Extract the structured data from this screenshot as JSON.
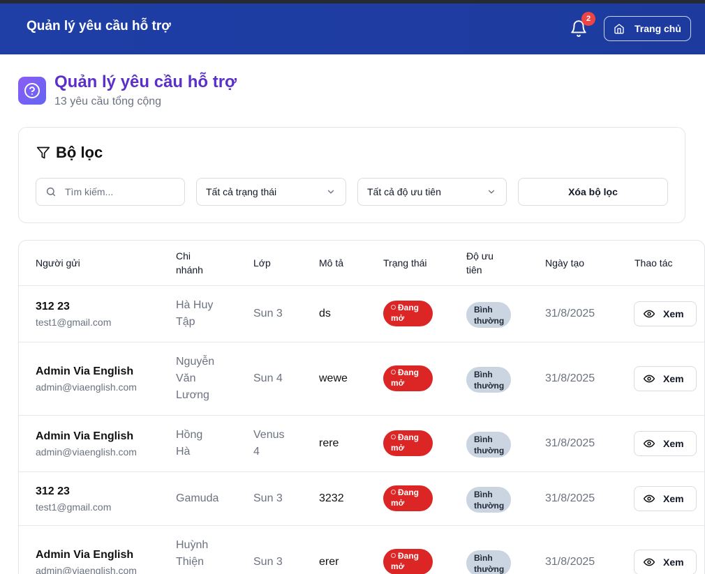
{
  "header": {
    "app_title": "Quản lý yêu cầu hỗ trợ",
    "notification_count": "2",
    "home_label": "Trang chủ"
  },
  "page": {
    "title": "Quản lý yêu cầu hỗ trợ",
    "subtitle": "13 yêu cầu tổng cộng"
  },
  "filters": {
    "title": "Bộ lọc",
    "search_placeholder": "Tìm kiếm...",
    "status_value": "Tất cả trạng thái",
    "priority_value": "Tất cả độ ưu tiên",
    "clear_label": "Xóa bộ lọc"
  },
  "table": {
    "columns": [
      "Người gửi",
      "Chi nhánh",
      "Lớp",
      "Mô tả",
      "Trạng thái",
      "Độ ưu tiên",
      "Ngày tạo",
      "Thao tác"
    ],
    "rows": [
      {
        "name": "312 23",
        "email": "test1@gmail.com",
        "branch": "Hà Huy Tập",
        "class": "Sun 3",
        "desc": "ds",
        "status": "Đang mở",
        "priority": "Bình thường",
        "date": "31/8/2025",
        "action": "Xem"
      },
      {
        "name": "Admin Via English",
        "email": "admin@viaenglish.com",
        "branch": "Nguyễn Văn Lương",
        "class": "Sun 4",
        "desc": "wewe",
        "status": "Đang mở",
        "priority": "Bình thường",
        "date": "31/8/2025",
        "action": "Xem"
      },
      {
        "name": "Admin Via English",
        "email": "admin@viaenglish.com",
        "branch": "Hồng Hà",
        "class": "Venus 4",
        "desc": "rere",
        "status": "Đang mở",
        "priority": "Bình thường",
        "date": "31/8/2025",
        "action": "Xem"
      },
      {
        "name": "312 23",
        "email": "test1@gmail.com",
        "branch": "Gamuda",
        "class": "Sun 3",
        "desc": "3232",
        "status": "Đang mở",
        "priority": "Bình thường",
        "date": "31/8/2025",
        "action": "Xem"
      },
      {
        "name": "Admin Via English",
        "email": "admin@viaenglish.com",
        "branch": "Huỳnh Thiện",
        "class": "Sun 3",
        "desc": "erer",
        "status": "Đang mở",
        "priority": "Bình thường",
        "date": "31/8/2025",
        "action": "Xem"
      }
    ]
  },
  "colors": {
    "header_bg": "#1f3ea6",
    "title_purple": "#5b2fc9",
    "status_open": "#dc2626",
    "priority_normal": "#cbd5e1"
  }
}
